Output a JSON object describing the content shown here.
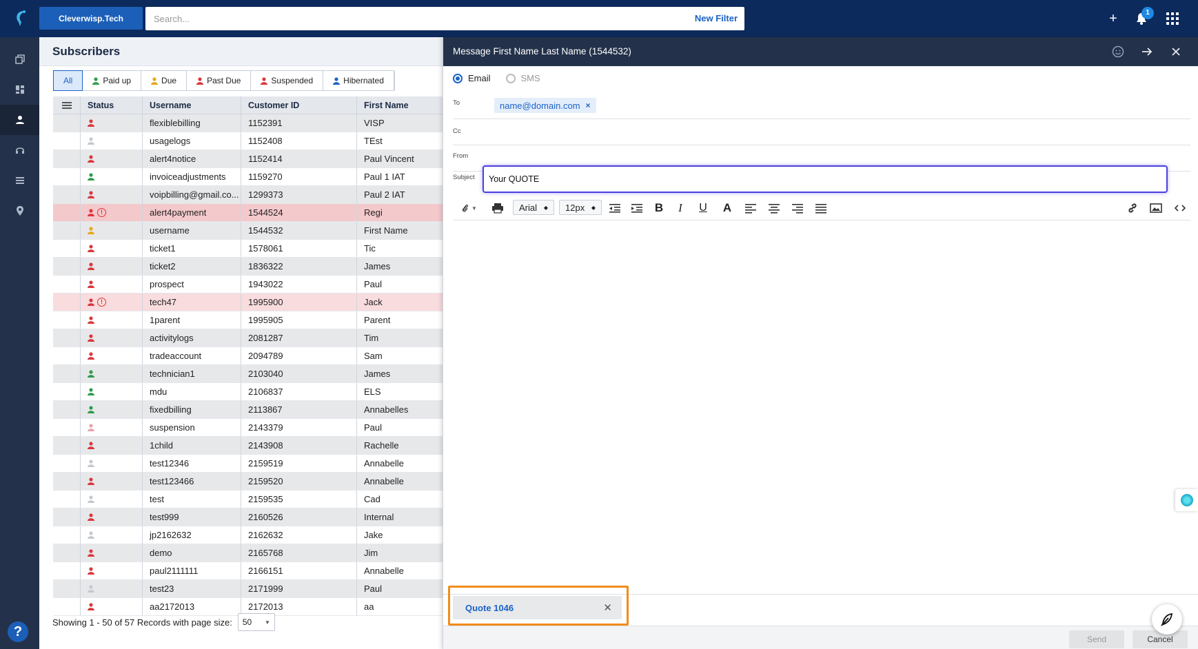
{
  "topbar": {
    "tenant": "Cleverwisp.Tech",
    "search_placeholder": "Search...",
    "new_filter": "New Filter",
    "notification_count": "1"
  },
  "subscribers": {
    "title": "Subscribers",
    "tabs": [
      {
        "label": "All",
        "color": ""
      },
      {
        "label": "Paid up",
        "color": "#2e9b4a"
      },
      {
        "label": "Due",
        "color": "#e6a817"
      },
      {
        "label": "Past Due",
        "color": "#d9373c"
      },
      {
        "label": "Suspended",
        "color": "#d9373c"
      },
      {
        "label": "Hibernated",
        "color": "#1a62c6"
      }
    ],
    "columns": [
      "Status",
      "Username",
      "Customer ID",
      "First Name"
    ],
    "rows": [
      {
        "status": "#d9373c",
        "alert": false,
        "username": "flexiblebilling",
        "id": "1152391",
        "first": "VISP"
      },
      {
        "status": "#c5c8cc",
        "alert": false,
        "username": "usagelogs",
        "id": "1152408",
        "first": "TEst"
      },
      {
        "status": "#d9373c",
        "alert": false,
        "username": "alert4notice",
        "id": "1152414",
        "first": "Paul Vincent"
      },
      {
        "status": "#2e9b4a",
        "alert": false,
        "username": "invoiceadjustments",
        "id": "1159270",
        "first": "Paul 1 IAT"
      },
      {
        "status": "#d9373c",
        "alert": false,
        "username": "voipbilling@gmail.co...",
        "id": "1299373",
        "first": "Paul 2 IAT"
      },
      {
        "status": "#d9373c",
        "alert": true,
        "username": "alert4payment",
        "id": "1544524",
        "first": "Regi"
      },
      {
        "status": "#e6a817",
        "alert": false,
        "username": "username",
        "id": "1544532",
        "first": "First Name"
      },
      {
        "status": "#d9373c",
        "alert": false,
        "username": "ticket1",
        "id": "1578061",
        "first": "Tic"
      },
      {
        "status": "#d9373c",
        "alert": false,
        "username": "ticket2",
        "id": "1836322",
        "first": "James"
      },
      {
        "status": "#d9373c",
        "alert": false,
        "username": "prospect",
        "id": "1943022",
        "first": "Paul"
      },
      {
        "status": "#d9373c",
        "alert": true,
        "username": "tech47",
        "id": "1995900",
        "first": "Jack"
      },
      {
        "status": "#d9373c",
        "alert": false,
        "username": "1parent",
        "id": "1995905",
        "first": "Parent"
      },
      {
        "status": "#d9373c",
        "alert": false,
        "username": "activitylogs",
        "id": "2081287",
        "first": "Tim"
      },
      {
        "status": "#d9373c",
        "alert": false,
        "username": "tradeaccount",
        "id": "2094789",
        "first": "Sam"
      },
      {
        "status": "#2e9b4a",
        "alert": false,
        "username": "technician1",
        "id": "2103040",
        "first": "James"
      },
      {
        "status": "#2e9b4a",
        "alert": false,
        "username": "mdu",
        "id": "2106837",
        "first": "ELS"
      },
      {
        "status": "#2e9b4a",
        "alert": false,
        "username": "fixedbilling",
        "id": "2113867",
        "first": "Annabelles"
      },
      {
        "status": "#e8a5a8",
        "alert": false,
        "username": "suspension",
        "id": "2143379",
        "first": "Paul"
      },
      {
        "status": "#d9373c",
        "alert": false,
        "username": "1child",
        "id": "2143908",
        "first": "Rachelle"
      },
      {
        "status": "#c5c8cc",
        "alert": false,
        "username": "test12346",
        "id": "2159519",
        "first": "Annabelle"
      },
      {
        "status": "#d9373c",
        "alert": false,
        "username": "test123466",
        "id": "2159520",
        "first": "Annabelle"
      },
      {
        "status": "#c5c8cc",
        "alert": false,
        "username": "test",
        "id": "2159535",
        "first": "Cad"
      },
      {
        "status": "#d9373c",
        "alert": false,
        "username": "test999",
        "id": "2160526",
        "first": "Internal"
      },
      {
        "status": "#c5c8cc",
        "alert": false,
        "username": "jp2162632",
        "id": "2162632",
        "first": "Jake"
      },
      {
        "status": "#d9373c",
        "alert": false,
        "username": "demo",
        "id": "2165768",
        "first": "Jim"
      },
      {
        "status": "#d9373c",
        "alert": false,
        "username": "paul2111111",
        "id": "2166151",
        "first": "Annabelle"
      },
      {
        "status": "#c5c8cc",
        "alert": false,
        "username": "test23",
        "id": "2171999",
        "first": "Paul"
      },
      {
        "status": "#d9373c",
        "alert": false,
        "username": "aa2172013",
        "id": "2172013",
        "first": "aa"
      }
    ],
    "pager_text": "Showing 1 - 50 of 57 Records with page size:",
    "page_size": "50"
  },
  "message": {
    "title": "Message First Name Last Name (1544532)",
    "email_label": "Email",
    "sms_label": "SMS",
    "to_label": "To",
    "to_chip": "name@domain.com",
    "cc_label": "Cc",
    "from_label": "From",
    "subject_label": "Subject",
    "subject_value": "Your QUOTE",
    "font_name": "Arial",
    "font_size": "12px",
    "attachment": "Quote 1046",
    "send_label": "Send",
    "cancel_label": "Cancel"
  }
}
